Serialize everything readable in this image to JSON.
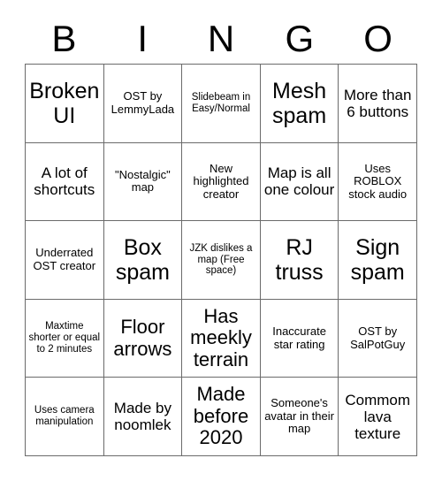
{
  "header": {
    "letters": [
      "B",
      "I",
      "N",
      "G",
      "O"
    ]
  },
  "grid": {
    "rows": [
      [
        {
          "text": "Broken UI",
          "size": "t-xl"
        },
        {
          "text": "OST by LemmyLada",
          "size": "t-sm"
        },
        {
          "text": "Slidebeam in Easy/Normal",
          "size": "t-xs"
        },
        {
          "text": "Mesh spam",
          "size": "t-xl"
        },
        {
          "text": "More than 6 buttons",
          "size": "t-md"
        }
      ],
      [
        {
          "text": "A lot of shortcuts",
          "size": "t-md"
        },
        {
          "text": "\"Nostalgic\" map",
          "size": "t-sm"
        },
        {
          "text": "New highlighted creator",
          "size": "t-sm"
        },
        {
          "text": "Map is all one colour",
          "size": "t-md"
        },
        {
          "text": "Uses ROBLOX stock audio",
          "size": "t-sm"
        }
      ],
      [
        {
          "text": "Underrated OST creator",
          "size": "t-sm"
        },
        {
          "text": "Box spam",
          "size": "t-xl"
        },
        {
          "text": "JZK dislikes a map (Free space)",
          "size": "t-xs"
        },
        {
          "text": "RJ truss",
          "size": "t-xl"
        },
        {
          "text": "Sign spam",
          "size": "t-xl"
        }
      ],
      [
        {
          "text": "Maxtime shorter or equal to 2 minutes",
          "size": "t-xs"
        },
        {
          "text": "Floor arrows",
          "size": "t-lg"
        },
        {
          "text": "Has meekly terrain",
          "size": "t-lg"
        },
        {
          "text": "Inaccurate star rating",
          "size": "t-sm"
        },
        {
          "text": "OST by SalPotGuy",
          "size": "t-sm"
        }
      ],
      [
        {
          "text": "Uses camera manipulation",
          "size": "t-xs"
        },
        {
          "text": "Made by noomlek",
          "size": "t-md"
        },
        {
          "text": "Made before 2020",
          "size": "t-lg"
        },
        {
          "text": "Someone's avatar in their map",
          "size": "t-sm"
        },
        {
          "text": "Commom lava texture",
          "size": "t-md"
        }
      ]
    ]
  }
}
